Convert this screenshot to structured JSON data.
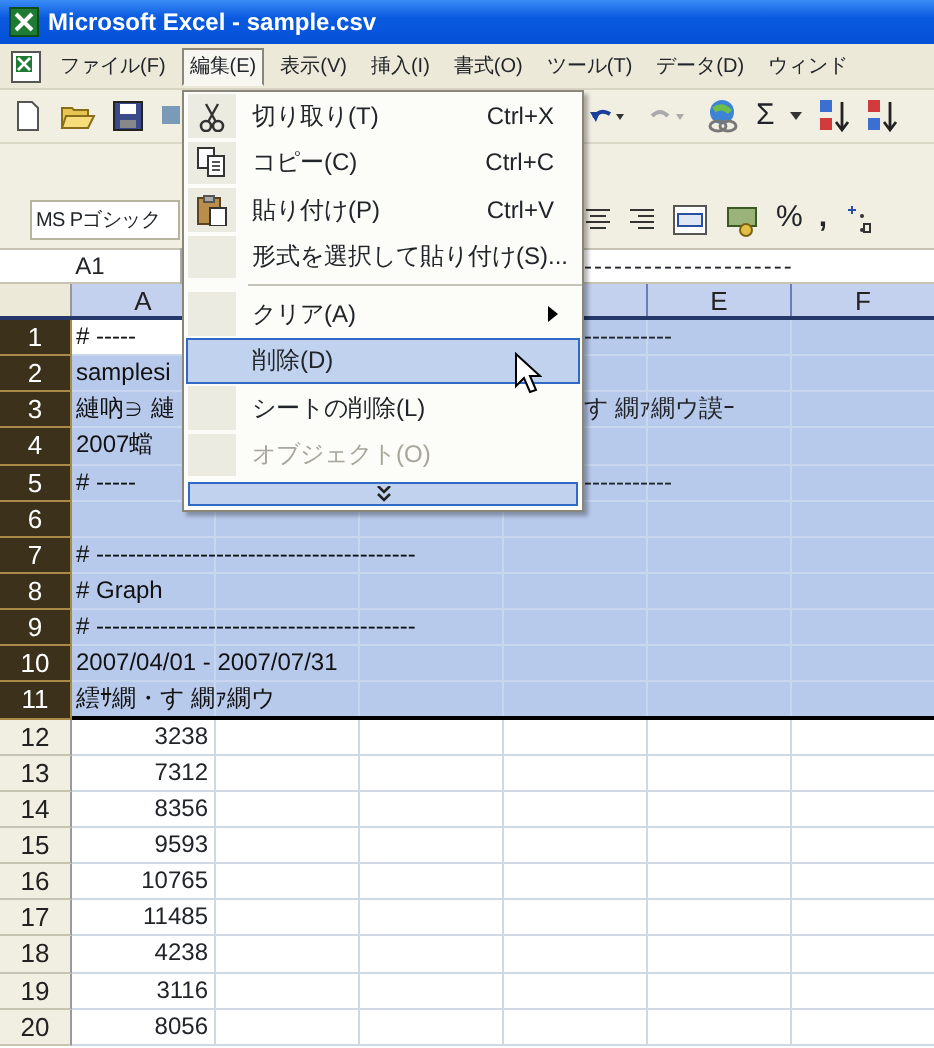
{
  "window": {
    "title": "Microsoft Excel - sample.csv"
  },
  "menu_bar": [
    {
      "label": "ファイル(F)",
      "selected": false
    },
    {
      "label": "編集(E)",
      "selected": true
    },
    {
      "label": "表示(V)",
      "selected": false
    },
    {
      "label": "挿入(I)",
      "selected": false
    },
    {
      "label": "書式(O)",
      "selected": false
    },
    {
      "label": "ツール(T)",
      "selected": false
    },
    {
      "label": "データ(D)",
      "selected": false
    },
    {
      "label": "ウィンド",
      "selected": false
    }
  ],
  "standard_toolbar": {
    "sum_symbol": "Σ"
  },
  "formatting_toolbar": {
    "font_name": "MS Pゴシック",
    "percent": "%",
    "comma": ","
  },
  "formula_bar": {
    "name_box": "A1",
    "formula": "---------------------"
  },
  "columns": [
    {
      "label": "A"
    },
    {
      "label": "E"
    },
    {
      "label": "F"
    }
  ],
  "rows": [
    {
      "number": "1",
      "selected": true,
      "cells": [
        {
          "kind": "text",
          "text": "# -----",
          "active": true
        },
        {
          "kind": "after_menu",
          "text": "-----------"
        }
      ]
    },
    {
      "number": "2",
      "selected": true,
      "cells": [
        {
          "kind": "text",
          "text": "samplesi"
        }
      ]
    },
    {
      "number": "3",
      "selected": true,
      "cells": [
        {
          "kind": "text",
          "text": "縺吶∋ 縺"
        },
        {
          "kind": "after_menu",
          "text": "す 繝ｧ繝ウ謨ｰ"
        }
      ]
    },
    {
      "number": "4",
      "selected": true,
      "cells": [
        {
          "kind": "text",
          "text": "2007蟷"
        }
      ]
    },
    {
      "number": "5",
      "selected": true,
      "cells": [
        {
          "kind": "text",
          "text": "# -----"
        },
        {
          "kind": "after_menu",
          "text": "-----------"
        }
      ]
    },
    {
      "number": "6",
      "selected": true,
      "cells": []
    },
    {
      "number": "7",
      "selected": true,
      "cells": [
        {
          "kind": "text",
          "text": "# ----------------------------------------"
        }
      ]
    },
    {
      "number": "8",
      "selected": true,
      "cells": [
        {
          "kind": "text",
          "text": "# Graph"
        }
      ]
    },
    {
      "number": "9",
      "selected": true,
      "cells": [
        {
          "kind": "text",
          "text": "# ----------------------------------------"
        }
      ]
    },
    {
      "number": "10",
      "selected": true,
      "cells": [
        {
          "kind": "text",
          "text": "2007/04/01 - 2007/07/31"
        }
      ]
    },
    {
      "number": "11",
      "selected": true,
      "cells": [
        {
          "kind": "text",
          "text": "繧ｻ繝・す 繝ｧ繝ウ"
        }
      ]
    },
    {
      "number": "12",
      "selected": false,
      "cells": [
        {
          "kind": "number",
          "text": "3238"
        }
      ]
    },
    {
      "number": "13",
      "selected": false,
      "cells": [
        {
          "kind": "number",
          "text": "7312"
        }
      ]
    },
    {
      "number": "14",
      "selected": false,
      "cells": [
        {
          "kind": "number",
          "text": "8356"
        }
      ]
    },
    {
      "number": "15",
      "selected": false,
      "cells": [
        {
          "kind": "number",
          "text": "9593"
        }
      ]
    },
    {
      "number": "16",
      "selected": false,
      "cells": [
        {
          "kind": "number",
          "text": "10765"
        }
      ]
    },
    {
      "number": "17",
      "selected": false,
      "cells": [
        {
          "kind": "number",
          "text": "11485"
        }
      ]
    },
    {
      "number": "18",
      "selected": false,
      "cells": [
        {
          "kind": "number",
          "text": "4238"
        }
      ]
    },
    {
      "number": "19",
      "selected": false,
      "cells": [
        {
          "kind": "number",
          "text": "3116"
        }
      ]
    },
    {
      "number": "20",
      "selected": false,
      "cells": [
        {
          "kind": "number",
          "text": "8056"
        }
      ]
    }
  ],
  "edit_menu": {
    "items": [
      {
        "kind": "item",
        "label": "切り取り(T)",
        "shortcut": "Ctrl+X",
        "selected": false,
        "disabled": false
      },
      {
        "kind": "item",
        "label": "コピー(C)",
        "shortcut": "Ctrl+C",
        "selected": false,
        "disabled": false
      },
      {
        "kind": "item",
        "label": "貼り付け(P)",
        "shortcut": "Ctrl+V",
        "selected": false,
        "disabled": false
      },
      {
        "kind": "item",
        "label": "形式を選択して貼り付け(S)...",
        "selected": false,
        "disabled": false
      },
      {
        "kind": "separator"
      },
      {
        "kind": "item",
        "label": "クリア(A)",
        "submenu": true,
        "selected": false,
        "disabled": false
      },
      {
        "kind": "item",
        "label": "削除(D)",
        "selected": true,
        "disabled": false
      },
      {
        "kind": "item",
        "label": "シートの削除(L)",
        "selected": false,
        "disabled": false
      },
      {
        "kind": "item",
        "label": "オブジェクト(O)",
        "selected": false,
        "disabled": true
      },
      {
        "kind": "expand"
      }
    ]
  }
}
